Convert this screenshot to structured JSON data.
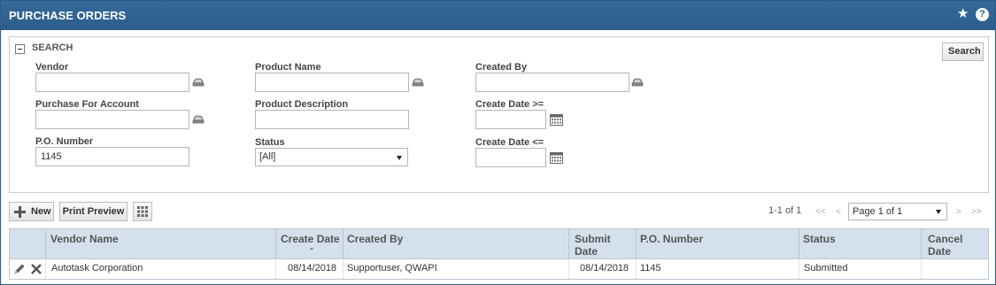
{
  "header": {
    "title": "PURCHASE ORDERS",
    "favorite_icon": "star-icon",
    "help_icon": "help-icon",
    "help_glyph": "?"
  },
  "search": {
    "heading": "SEARCH",
    "search_button": "Search",
    "fields": {
      "vendor": {
        "label": "Vendor",
        "value": ""
      },
      "purchase_for_account": {
        "label": "Purchase For Account",
        "value": ""
      },
      "po_number": {
        "label": "P.O. Number",
        "value": "1145"
      },
      "product_name": {
        "label": "Product Name",
        "value": ""
      },
      "product_description": {
        "label": "Product Description",
        "value": ""
      },
      "status": {
        "label": "Status",
        "value": "[All]"
      },
      "created_by": {
        "label": "Created By",
        "value": ""
      },
      "create_date_from": {
        "label": "Create Date >=",
        "value": ""
      },
      "create_date_to": {
        "label": "Create Date <=",
        "value": ""
      }
    }
  },
  "toolbar": {
    "new_label": "New",
    "print_preview_label": "Print Preview",
    "column_chooser_icon": "grid-icon"
  },
  "pagination": {
    "count_text": "1-1 of 1",
    "first": "<<",
    "prev": "<",
    "page_select": "Page 1 of 1",
    "next": ">",
    "last": ">>"
  },
  "table": {
    "columns": [
      "Vendor Name",
      "Create Date",
      "Created By",
      "Submit Date",
      "P.O. Number",
      "Status",
      "Cancel Date"
    ],
    "rows": [
      {
        "vendor_name": "Autotask Corporation",
        "create_date": "08/14/2018",
        "created_by": "Supportuser, QWAPI",
        "submit_date": "08/14/2018",
        "po_number": "1145",
        "status": "Submitted",
        "cancel_date": ""
      }
    ]
  }
}
